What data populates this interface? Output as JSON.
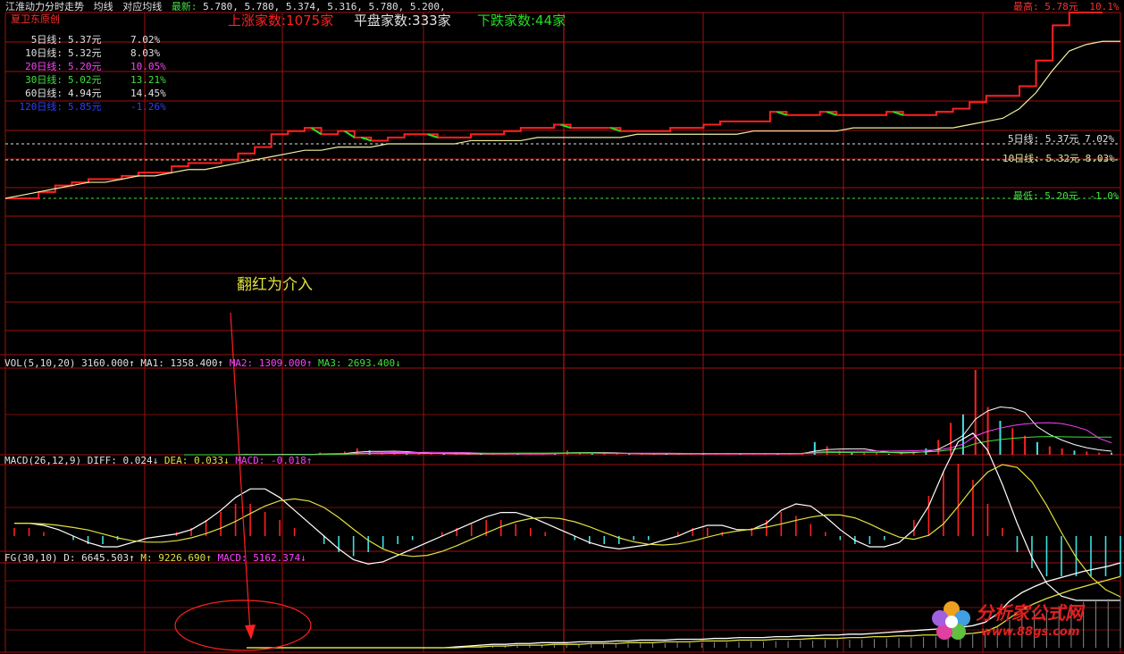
{
  "header": {
    "title": "江淮动力分时走势",
    "tabs": [
      "均线",
      "对应均线"
    ],
    "latest_label": "最新:",
    "latest_values": "5.780, 5.780, 5.374, 5.316, 5.780, 5.200,",
    "source": "夏卫东原创",
    "advancers": "上涨家数:1075家",
    "flat": "平盘家数:333家",
    "decliners": "下跌家数:44家"
  },
  "ma_list": [
    {
      "label": "5日线:",
      "price": "5.37元",
      "pct": "7.02%",
      "color": "#e0e0e0"
    },
    {
      "label": "10日线:",
      "price": "5.32元",
      "pct": "8.03%",
      "color": "#e0e0e0"
    },
    {
      "label": "20日线:",
      "price": "5.20元",
      "pct": "10.05%",
      "color": "#ff40ff"
    },
    {
      "label": "30日线:",
      "price": "5.02元",
      "pct": "13.21%",
      "color": "#40e040"
    },
    {
      "label": "60日线:",
      "price": "4.94元",
      "pct": "14.45%",
      "color": "#e0e0e0"
    },
    {
      "label": "120日线:",
      "price": "5.85元",
      "pct": "-1.26%",
      "color": "#2a40ff"
    }
  ],
  "price_panel": {
    "high_label": "最高:",
    "high_value": "5.78元",
    "high_pct": "10.1%",
    "low_label": "最低:",
    "low_value": "5.20元",
    "low_pct": "-1.0%",
    "ma5_label": "5日线:",
    "ma5_value": "5.37元",
    "ma5_pct": "7.02%",
    "ma10_label": "10日线:",
    "ma10_value": "5.32元",
    "ma10_pct": "8.03%",
    "annotation": "翻红为介入"
  },
  "vol_panel": {
    "name": "VOL(5,10,20)",
    "value": "3160.000↑",
    "ma1": "MA1: 1358.400↑",
    "ma2": "MA2: 1309.000↑",
    "ma3": "MA3: 2693.400↓"
  },
  "macd_panel": {
    "name": "MACD(26,12,9)",
    "diff": "DIFF: 0.024↓",
    "dea": "DEA: 0.033↓",
    "macd": "MACD: -0.018↑"
  },
  "fg_panel": {
    "name": "FG(30,10)",
    "d": "D: 6645.503↑",
    "m": "M: 9226.690↑",
    "macd": "MACD: 5162.374↓"
  },
  "watermark": {
    "title": "分析家公式网",
    "url": "www.88gs.com"
  },
  "colors": {
    "up": "#ff2020",
    "down": "#20e020",
    "grid": "#a01010",
    "avg": "#f0f0a0",
    "white": "#ffffff",
    "yellow": "#e0e040",
    "magenta": "#ff40ff",
    "green": "#40e040",
    "cyan": "#40e0e0"
  },
  "chart_data": {
    "type": "line",
    "ylim": [
      5.2,
      5.78
    ],
    "price": [
      5.2,
      5.2,
      5.22,
      5.24,
      5.25,
      5.26,
      5.26,
      5.27,
      5.28,
      5.28,
      5.3,
      5.31,
      5.31,
      5.32,
      5.34,
      5.36,
      5.4,
      5.41,
      5.42,
      5.4,
      5.41,
      5.39,
      5.38,
      5.39,
      5.4,
      5.4,
      5.39,
      5.39,
      5.4,
      5.4,
      5.41,
      5.42,
      5.42,
      5.43,
      5.42,
      5.42,
      5.42,
      5.41,
      5.41,
      5.41,
      5.42,
      5.42,
      5.43,
      5.44,
      5.44,
      5.44,
      5.47,
      5.46,
      5.46,
      5.47,
      5.46,
      5.46,
      5.46,
      5.47,
      5.46,
      5.46,
      5.47,
      5.48,
      5.5,
      5.52,
      5.52,
      5.55,
      5.63,
      5.74,
      5.78,
      5.78,
      5.78
    ],
    "avg": [
      5.2,
      5.21,
      5.22,
      5.23,
      5.24,
      5.25,
      5.25,
      5.26,
      5.27,
      5.27,
      5.28,
      5.29,
      5.29,
      5.3,
      5.31,
      5.32,
      5.33,
      5.34,
      5.35,
      5.35,
      5.36,
      5.36,
      5.36,
      5.37,
      5.37,
      5.37,
      5.37,
      5.37,
      5.38,
      5.38,
      5.38,
      5.38,
      5.39,
      5.39,
      5.39,
      5.39,
      5.39,
      5.39,
      5.4,
      5.4,
      5.4,
      5.4,
      5.4,
      5.4,
      5.4,
      5.41,
      5.41,
      5.41,
      5.41,
      5.41,
      5.41,
      5.42,
      5.42,
      5.42,
      5.42,
      5.42,
      5.42,
      5.42,
      5.43,
      5.44,
      5.45,
      5.48,
      5.53,
      5.6,
      5.66,
      5.68,
      5.69
    ],
    "volume": [
      0,
      0,
      0,
      0,
      0,
      1,
      0,
      0,
      1,
      0,
      0,
      2,
      1,
      3,
      6,
      4,
      2,
      2,
      1,
      1,
      1,
      1,
      1,
      1,
      1,
      1,
      1,
      1,
      1,
      1,
      2,
      4,
      2,
      1,
      1,
      1,
      1,
      1,
      1,
      1,
      1,
      1,
      1,
      1,
      1,
      1,
      1,
      1,
      1,
      1,
      2,
      12,
      8,
      4,
      2,
      2,
      2,
      1,
      2,
      3,
      6,
      14,
      30,
      38,
      80,
      45,
      32,
      25,
      18,
      12,
      8,
      6,
      4,
      3,
      2,
      2
    ],
    "macd_hist": [
      0.01,
      0.01,
      0.005,
      0.0,
      -0.005,
      -0.01,
      -0.01,
      -0.005,
      0.0,
      0.0,
      0.0,
      0.005,
      0.01,
      0.02,
      0.03,
      0.04,
      0.04,
      0.03,
      0.02,
      0.01,
      0.0,
      -0.01,
      -0.02,
      -0.025,
      -0.02,
      -0.015,
      -0.01,
      -0.005,
      0.0,
      0.005,
      0.01,
      0.015,
      0.02,
      0.02,
      0.015,
      0.01,
      0.005,
      0.0,
      -0.005,
      -0.01,
      -0.01,
      -0.01,
      -0.005,
      -0.005,
      0.0,
      0.005,
      0.01,
      0.01,
      0.005,
      0.0,
      0.01,
      0.02,
      0.03,
      0.025,
      0.015,
      0.005,
      -0.005,
      -0.01,
      -0.01,
      -0.005,
      0.0,
      0.02,
      0.05,
      0.08,
      0.09,
      0.07,
      0.04,
      0.01,
      -0.02,
      -0.04,
      -0.05,
      -0.05,
      -0.05,
      -0.05,
      -0.05,
      -0.05
    ],
    "fg_d": [
      0,
      0,
      0,
      0,
      0,
      0,
      0,
      0,
      0,
      0,
      0,
      0,
      0,
      0,
      0,
      0,
      0,
      1,
      2,
      3,
      4,
      4,
      5,
      5,
      6,
      6,
      6,
      7,
      7,
      7,
      8,
      8,
      9,
      9,
      9,
      10,
      10,
      10,
      11,
      11,
      12,
      12,
      12,
      13,
      13,
      14,
      14,
      15,
      15,
      16,
      16,
      17,
      18,
      19,
      20,
      21,
      22,
      23,
      24,
      26,
      30,
      40,
      55,
      65,
      72,
      78,
      82,
      86,
      90,
      93,
      96,
      100
    ],
    "fg_m": [
      0,
      0,
      0,
      0,
      0,
      0,
      0,
      0,
      0,
      0,
      0,
      0,
      0,
      0,
      0,
      0,
      0,
      0,
      1,
      1,
      2,
      2,
      3,
      3,
      3,
      4,
      4,
      4,
      5,
      5,
      5,
      6,
      6,
      6,
      7,
      7,
      7,
      8,
      8,
      8,
      9,
      9,
      9,
      10,
      10,
      10,
      11,
      11,
      11,
      12,
      12,
      13,
      13,
      14,
      14,
      15,
      15,
      16,
      16,
      17,
      19,
      25,
      35,
      45,
      52,
      58,
      63,
      68,
      72,
      76,
      80,
      84
    ]
  }
}
